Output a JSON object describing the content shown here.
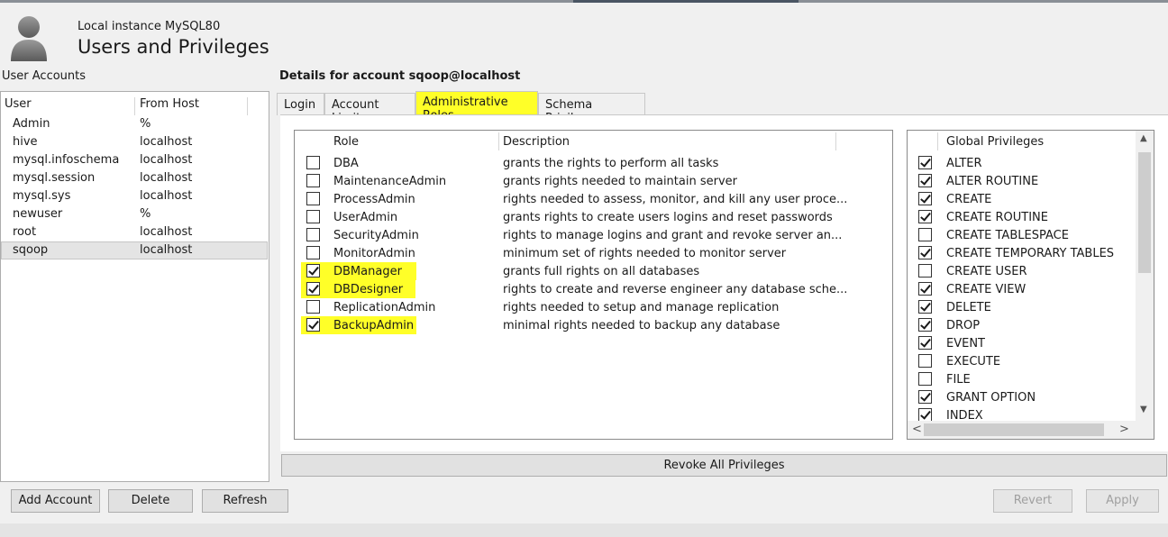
{
  "header": {
    "instance": "Local instance MySQL80",
    "title": "Users and Privileges"
  },
  "user_accounts": {
    "label": "User Accounts",
    "columns": [
      "User",
      "From Host"
    ],
    "rows": [
      {
        "user": "Admin",
        "host": "%"
      },
      {
        "user": "hive",
        "host": "localhost"
      },
      {
        "user": "mysql.infoschema",
        "host": "localhost"
      },
      {
        "user": "mysql.session",
        "host": "localhost"
      },
      {
        "user": "mysql.sys",
        "host": "localhost"
      },
      {
        "user": "newuser",
        "host": "%"
      },
      {
        "user": "root",
        "host": "localhost"
      },
      {
        "user": "sqoop",
        "host": "localhost"
      }
    ],
    "selected": "sqoop"
  },
  "details": {
    "title": "Details for account sqoop@localhost",
    "tabs": [
      "Login",
      "Account Limits",
      "Administrative Roles",
      "Schema Privileges"
    ],
    "active_tab": "Administrative Roles"
  },
  "roles": {
    "columns": [
      "Role",
      "Description"
    ],
    "rows": [
      {
        "role": "DBA",
        "description": "grants the rights to perform all tasks",
        "checked": false
      },
      {
        "role": "MaintenanceAdmin",
        "description": "grants rights needed to maintain server",
        "checked": false
      },
      {
        "role": "ProcessAdmin",
        "description": "rights needed to assess, monitor, and kill any user proce...",
        "checked": false
      },
      {
        "role": "UserAdmin",
        "description": "grants rights to create users logins and reset passwords",
        "checked": false
      },
      {
        "role": "SecurityAdmin",
        "description": "rights to manage logins and grant and revoke server an...",
        "checked": false
      },
      {
        "role": "MonitorAdmin",
        "description": "minimum set of rights needed to monitor server",
        "checked": false
      },
      {
        "role": "DBManager",
        "description": "grants full rights on all databases",
        "checked": true
      },
      {
        "role": "DBDesigner",
        "description": "rights to create and reverse engineer any database sche...",
        "checked": true
      },
      {
        "role": "ReplicationAdmin",
        "description": "rights needed to setup and manage replication",
        "checked": false
      },
      {
        "role": "BackupAdmin",
        "description": "minimal rights needed to backup any database",
        "checked": true
      }
    ],
    "highlight_color": "#ffff28"
  },
  "global_privileges": {
    "header": "Global Privileges",
    "items": [
      {
        "name": "ALTER",
        "checked": true
      },
      {
        "name": "ALTER ROUTINE",
        "checked": true
      },
      {
        "name": "CREATE",
        "checked": true
      },
      {
        "name": "CREATE ROUTINE",
        "checked": true
      },
      {
        "name": "CREATE TABLESPACE",
        "checked": false
      },
      {
        "name": "CREATE TEMPORARY TABLES",
        "checked": true
      },
      {
        "name": "CREATE USER",
        "checked": false
      },
      {
        "name": "CREATE VIEW",
        "checked": true
      },
      {
        "name": "DELETE",
        "checked": true
      },
      {
        "name": "DROP",
        "checked": true
      },
      {
        "name": "EVENT",
        "checked": true
      },
      {
        "name": "EXECUTE",
        "checked": false
      },
      {
        "name": "FILE",
        "checked": false
      },
      {
        "name": "GRANT OPTION",
        "checked": true
      },
      {
        "name": "INDEX",
        "checked": true
      }
    ]
  },
  "buttons": {
    "revoke_all": "Revoke All Privileges",
    "add_account": "Add Account",
    "delete": "Delete",
    "refresh": "Refresh",
    "revert": "Revert",
    "apply": "Apply"
  },
  "icons": {
    "avatar": "user-avatar-icon",
    "scroll_up": "▲",
    "scroll_down": "▼",
    "scroll_left": "<",
    "scroll_right": ">"
  }
}
